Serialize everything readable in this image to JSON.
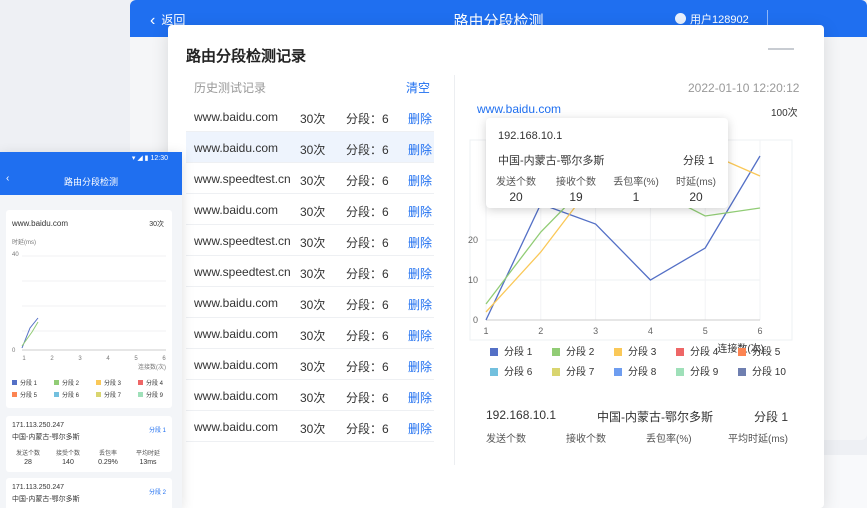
{
  "app": {
    "back_label": "返回",
    "title": "路由分段检测",
    "user": "用户128902"
  },
  "modal": {
    "title": "路由分段检测记录"
  },
  "history": {
    "header_label": "历史测试记录",
    "clear_label": "清空",
    "rows": [
      {
        "host": "www.baidu.com",
        "count": "30次",
        "segments": "分段：6",
        "delete": "删除"
      },
      {
        "host": "www.baidu.com",
        "count": "30次",
        "segments": "分段：6",
        "delete": "删除"
      },
      {
        "host": "www.speedtest.cn",
        "count": "30次",
        "segments": "分段：6",
        "delete": "删除"
      },
      {
        "host": "www.baidu.com",
        "count": "30次",
        "segments": "分段：6",
        "delete": "删除"
      },
      {
        "host": "www.speedtest.cn",
        "count": "30次",
        "segments": "分段：6",
        "delete": "删除"
      },
      {
        "host": "www.speedtest.cn",
        "count": "30次",
        "segments": "分段：6",
        "delete": "删除"
      },
      {
        "host": "www.baidu.com",
        "count": "30次",
        "segments": "分段：6",
        "delete": "删除"
      },
      {
        "host": "www.baidu.com",
        "count": "30次",
        "segments": "分段：6",
        "delete": "删除"
      },
      {
        "host": "www.baidu.com",
        "count": "30次",
        "segments": "分段：6",
        "delete": "删除"
      },
      {
        "host": "www.baidu.com",
        "count": "30次",
        "segments": "分段：6",
        "delete": "删除"
      },
      {
        "host": "www.baidu.com",
        "count": "30次",
        "segments": "分段：6",
        "delete": "删除"
      }
    ]
  },
  "detail": {
    "timestamp": "2022-01-10  12:20:12",
    "host": "www.baidu.com",
    "count": "100次",
    "tooltip": {
      "ip": "192.168.10.1",
      "location": "中国-内蒙古-鄂尔多斯",
      "segment": "分段 1",
      "cols": [
        {
          "label": "发送个数",
          "value": "20"
        },
        {
          "label": "接收个数",
          "value": "19"
        },
        {
          "label": "丢包率(%)",
          "value": "1"
        },
        {
          "label": "时延(ms)",
          "value": "20"
        }
      ]
    },
    "summary": {
      "ip": "192.168.10.1",
      "location": "中国-内蒙古-鄂尔多斯",
      "segment": "分段 1",
      "cols": [
        "发送个数",
        "接收个数",
        "丢包率(%)",
        "平均时延(ms)"
      ]
    }
  },
  "chart_data": {
    "type": "line",
    "xlabel": "连接数(次)",
    "ylabel": "",
    "x": [
      1,
      2,
      3,
      4,
      5,
      6
    ],
    "yticks": [
      "0",
      "10",
      "20"
    ],
    "ylim": [
      0,
      45
    ],
    "grid": true,
    "legend": "bottom",
    "series": [
      {
        "name": "分段 1",
        "color": "#5470c6",
        "values": [
          0,
          29,
          24,
          10,
          18,
          41
        ]
      },
      {
        "name": "分段 2",
        "color": "#91cc75",
        "values": [
          4,
          22,
          36,
          33,
          26,
          28
        ]
      },
      {
        "name": "分段 3",
        "color": "#fac858",
        "values": [
          2,
          17,
          35,
          37,
          42,
          36
        ]
      },
      {
        "name": "分段 4",
        "color": "#ee6666",
        "values": [
          null,
          null,
          null,
          null,
          null,
          null
        ]
      },
      {
        "name": "分段 5",
        "color": "#fc8452",
        "values": [
          null,
          null,
          null,
          null,
          null,
          null
        ]
      },
      {
        "name": "分段 6",
        "color": "#73c0de",
        "values": [
          null,
          null,
          null,
          null,
          null,
          null
        ]
      },
      {
        "name": "分段 7",
        "color": "#d9d56f",
        "values": [
          null,
          null,
          null,
          null,
          null,
          null
        ]
      },
      {
        "name": "分段 8",
        "color": "#6e9df0",
        "values": [
          null,
          null,
          null,
          null,
          null,
          null
        ]
      },
      {
        "name": "分段 9",
        "color": "#9fe0b9",
        "values": [
          null,
          null,
          null,
          null,
          null,
          null
        ]
      },
      {
        "name": "分段 10",
        "color": "#6f7fb0",
        "values": [
          null,
          null,
          null,
          null,
          null,
          null
        ]
      }
    ]
  },
  "mobile": {
    "status_time": "12:30",
    "title": "路由分段检测",
    "host": "www.baidu.com",
    "count": "30次",
    "y_axis_label": "时延(ms)",
    "x_axis_label": "连接数(次)",
    "y_ticks": [
      "40",
      "0"
    ],
    "x_ticks": [
      "1",
      "2",
      "3",
      "4",
      "5",
      "6"
    ],
    "legend": [
      "分段 1",
      "分段 2",
      "分段 3",
      "分段 4",
      "分段 5",
      "分段 6",
      "分段 7",
      "分段 9"
    ],
    "cards": [
      {
        "ip": "171.113.250.247",
        "segment": "分段 1",
        "location": "中国-内蒙古-鄂尔多斯",
        "cols": [
          {
            "label": "发送个数",
            "value": "28"
          },
          {
            "label": "接受个数",
            "value": "140"
          },
          {
            "label": "丢包率",
            "value": "0.29%"
          },
          {
            "label": "平均时延",
            "value": "13ms"
          }
        ]
      },
      {
        "ip": "171.113.250.247",
        "segment": "分段 2",
        "location": "中国-内蒙古-鄂尔多斯",
        "cols": []
      }
    ]
  }
}
